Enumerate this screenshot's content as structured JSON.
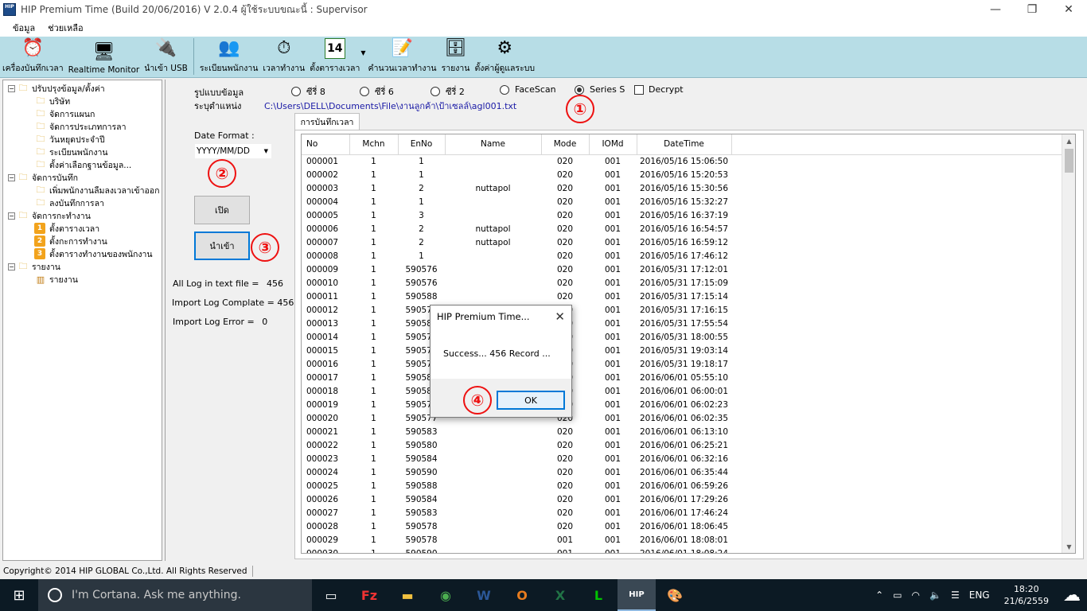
{
  "window": {
    "title": "HIP Premium Time (Build 20/06/2016) V 2.0.4   ผู้ใช้ระบบขณะนี้ : Supervisor",
    "app_icon": "HIP"
  },
  "menu": [
    "ข้อมูล",
    "ช่วยเหลือ"
  ],
  "toolbar": [
    {
      "label": "เครื่องบันทึกเวลา",
      "icon": "alarm-clock-icon",
      "glyph": "⏰"
    },
    {
      "label": "Realtime Monitor",
      "icon": "monitor-icon",
      "glyph": "🖥"
    },
    {
      "label": "นำเข้า USB",
      "icon": "usb-icon",
      "glyph": "🔌"
    },
    {
      "label": "ระเบียนพนักงาน",
      "icon": "people-icon",
      "glyph": "👥"
    },
    {
      "label": "เวลาทำงาน",
      "icon": "clock-icon",
      "glyph": "⏱"
    },
    {
      "label": "ตั้งตารางเวลา",
      "icon": "calendar-icon",
      "glyph": "14"
    },
    {
      "label": "คำนวนเวลาทำงาน",
      "icon": "document-icon",
      "glyph": "📝"
    },
    {
      "label": "รายงาน",
      "icon": "database-icon",
      "glyph": "🗄"
    },
    {
      "label": "ตั้งค่าผู้ดูแลระบบ",
      "icon": "admin-settings-icon",
      "glyph": "⚙"
    }
  ],
  "tree": [
    {
      "label": "ปรับปรุงข้อมูล/ตั้งค่า",
      "level": 0,
      "toggle": "−",
      "icon": "folder"
    },
    {
      "label": "บริษัท",
      "level": 1,
      "icon": "folder"
    },
    {
      "label": "จัดการแผนก",
      "level": 1,
      "icon": "folder"
    },
    {
      "label": "จัดการประเภทการลา",
      "level": 1,
      "icon": "folder"
    },
    {
      "label": "วันหยุดประจำปี",
      "level": 1,
      "icon": "folder"
    },
    {
      "label": "ระเบียนพนักงาน",
      "level": 1,
      "icon": "folder"
    },
    {
      "label": "ตั้งค่าเลือกฐานข้อมูล...",
      "level": 1,
      "icon": "folder"
    },
    {
      "label": "จัดการบันทึก",
      "level": 0,
      "toggle": "−",
      "icon": "folder"
    },
    {
      "label": "เพิ่มพนักงานลืมลงเวลาเข้าออก",
      "level": 1,
      "icon": "folder"
    },
    {
      "label": "ลงบันทึกการลา",
      "level": 1,
      "icon": "folder"
    },
    {
      "label": "จัดการกะทำงาน",
      "level": 0,
      "toggle": "−",
      "icon": "folder"
    },
    {
      "label": "ตั้งตารางเวลา",
      "level": 1,
      "icon": "num",
      "num": "1"
    },
    {
      "label": "ตั้งกะการทำงาน",
      "level": 1,
      "icon": "num",
      "num": "2"
    },
    {
      "label": "ตั้งตารางทำงานของพนักงาน",
      "level": 1,
      "icon": "num",
      "num": "3"
    },
    {
      "label": "รายงาน",
      "level": 0,
      "toggle": "−",
      "icon": "folder"
    },
    {
      "label": "รายงาน",
      "level": 1,
      "icon": "chart"
    }
  ],
  "form": {
    "format_label": "รูปแบบข้อมูล",
    "location_label": "ระบุตำแหน่ง",
    "radios": [
      {
        "label": "ซีรี่ 8",
        "selected": false
      },
      {
        "label": "ซีรี่ 6",
        "selected": false
      },
      {
        "label": "ซีรี่ 2",
        "selected": false
      },
      {
        "label": "FaceScan",
        "selected": false
      },
      {
        "label": "Series S",
        "selected": true
      }
    ],
    "decrypt_label": "Decrypt",
    "decrypt_checked": false,
    "file_path": "C:\\Users\\DELL\\Documents\\File\\งานลูกค้า\\ป้าเซลล์\\agl001.txt",
    "date_format_label": "Date Format :",
    "date_format_value": "YYYY/MM/DD",
    "open_button": "เปิด",
    "import_button": "นำเข้า",
    "stats": {
      "all_log_label": "All Log in text file =",
      "all_log_value": "456",
      "import_complete_label": "Import Log Complate =",
      "import_complete_value": "456",
      "import_error_label": "Import Log Error =",
      "import_error_value": "0"
    }
  },
  "annotations": [
    "①",
    "②",
    "③",
    "④"
  ],
  "tab_label": "การบันทึกเวลา",
  "grid": {
    "columns": [
      "No",
      "Mchn",
      "EnNo",
      "Name",
      "Mode",
      "IOMd",
      "DateTime"
    ],
    "rows": [
      [
        "000001",
        "1",
        "1",
        "",
        "020",
        "001",
        "2016/05/16  15:06:50"
      ],
      [
        "000002",
        "1",
        "1",
        "",
        "020",
        "001",
        "2016/05/16  15:20:53"
      ],
      [
        "000003",
        "1",
        "2",
        "nuttapol",
        "020",
        "001",
        "2016/05/16  15:30:56"
      ],
      [
        "000004",
        "1",
        "1",
        "",
        "020",
        "001",
        "2016/05/16  15:32:27"
      ],
      [
        "000005",
        "1",
        "3",
        "",
        "020",
        "001",
        "2016/05/16  16:37:19"
      ],
      [
        "000006",
        "1",
        "2",
        "nuttapol",
        "020",
        "001",
        "2016/05/16  16:54:57"
      ],
      [
        "000007",
        "1",
        "2",
        "nuttapol",
        "020",
        "001",
        "2016/05/16  16:59:12"
      ],
      [
        "000008",
        "1",
        "1",
        "",
        "020",
        "001",
        "2016/05/16  17:46:12"
      ],
      [
        "000009",
        "1",
        "590576",
        "",
        "020",
        "001",
        "2016/05/31  17:12:01"
      ],
      [
        "000010",
        "1",
        "590576",
        "",
        "020",
        "001",
        "2016/05/31  17:15:09"
      ],
      [
        "000011",
        "1",
        "590588",
        "",
        "020",
        "001",
        "2016/05/31  17:15:14"
      ],
      [
        "000012",
        "1",
        "590576",
        "",
        "020",
        "001",
        "2016/05/31  17:16:15"
      ],
      [
        "000013",
        "1",
        "590583",
        "",
        "020",
        "001",
        "2016/05/31  17:55:54"
      ],
      [
        "000014",
        "1",
        "590576",
        "",
        "020",
        "001",
        "2016/05/31  18:00:55"
      ],
      [
        "000015",
        "1",
        "590576",
        "",
        "020",
        "001",
        "2016/05/31  19:03:14"
      ],
      [
        "000016",
        "1",
        "590576",
        "",
        "020",
        "001",
        "2016/05/31  19:18:17"
      ],
      [
        "000017",
        "1",
        "590585",
        "",
        "020",
        "001",
        "2016/06/01  05:55:10"
      ],
      [
        "000018",
        "1",
        "590586",
        "",
        "020",
        "001",
        "2016/06/01  06:00:01"
      ],
      [
        "000019",
        "1",
        "590578",
        "",
        "020",
        "001",
        "2016/06/01  06:02:23"
      ],
      [
        "000020",
        "1",
        "590577",
        "",
        "020",
        "001",
        "2016/06/01  06:02:35"
      ],
      [
        "000021",
        "1",
        "590583",
        "",
        "020",
        "001",
        "2016/06/01  06:13:10"
      ],
      [
        "000022",
        "1",
        "590580",
        "",
        "020",
        "001",
        "2016/06/01  06:25:21"
      ],
      [
        "000023",
        "1",
        "590584",
        "",
        "020",
        "001",
        "2016/06/01  06:32:16"
      ],
      [
        "000024",
        "1",
        "590590",
        "",
        "020",
        "001",
        "2016/06/01  06:35:44"
      ],
      [
        "000025",
        "1",
        "590588",
        "",
        "020",
        "001",
        "2016/06/01  06:59:26"
      ],
      [
        "000026",
        "1",
        "590584",
        "",
        "020",
        "001",
        "2016/06/01  17:29:26"
      ],
      [
        "000027",
        "1",
        "590583",
        "",
        "020",
        "001",
        "2016/06/01  17:46:24"
      ],
      [
        "000028",
        "1",
        "590578",
        "",
        "020",
        "001",
        "2016/06/01  18:06:45"
      ],
      [
        "000029",
        "1",
        "590578",
        "",
        "001",
        "001",
        "2016/06/01  18:08:01"
      ],
      [
        "000030",
        "1",
        "590590",
        "",
        "001",
        "001",
        "2016/06/01  18:08:24"
      ]
    ]
  },
  "dialog": {
    "title": "HIP Premium Time...",
    "message": "Success... 456 Record ...",
    "ok_label": "OK"
  },
  "status": "Copyright© 2014 HIP GLOBAL Co.,Ltd. All Rights Reserved",
  "taskbar": {
    "search_placeholder": "I'm Cortana. Ask me anything.",
    "apps": [
      {
        "name": "task-view-icon",
        "glyph": "▭"
      },
      {
        "name": "filezilla-icon",
        "glyph": "Fz"
      },
      {
        "name": "file-explorer-icon",
        "glyph": "▬"
      },
      {
        "name": "chrome-icon",
        "glyph": "◉"
      },
      {
        "name": "word-icon",
        "glyph": "W"
      },
      {
        "name": "outlook-icon",
        "glyph": "O"
      },
      {
        "name": "excel-icon",
        "glyph": "X"
      },
      {
        "name": "line-icon",
        "glyph": "L"
      },
      {
        "name": "hip-premium-time-icon",
        "glyph": "HIP"
      },
      {
        "name": "paint-icon",
        "glyph": "🎨"
      }
    ],
    "tray": {
      "chevron": "⌃",
      "battery": "▭",
      "wifi": "◠",
      "volume": "🔈",
      "message": "☰",
      "lang": "ENG"
    },
    "time": "18:20",
    "date": "21/6/2559",
    "weather": "☁"
  }
}
